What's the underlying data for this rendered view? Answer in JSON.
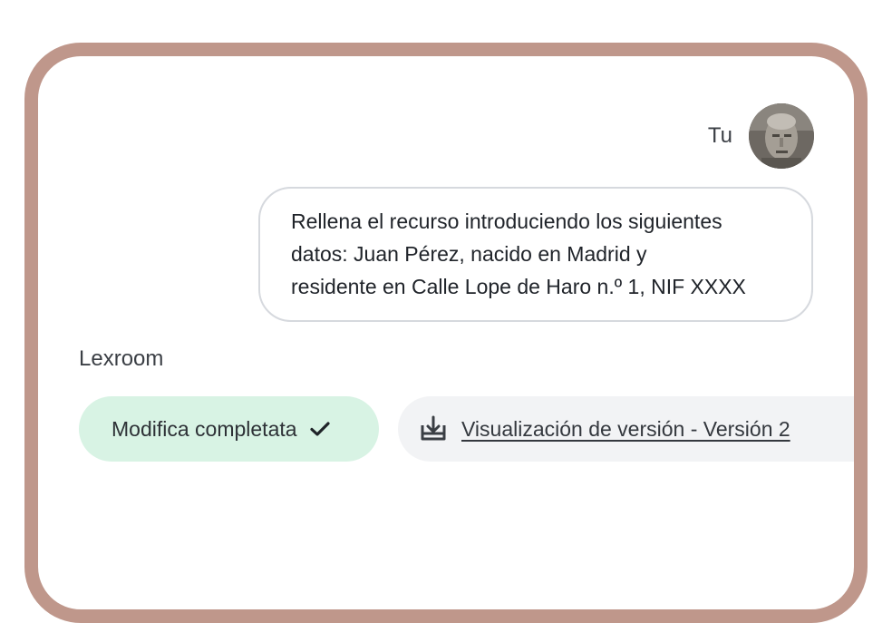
{
  "user": {
    "name": "Tu",
    "avatar_icon": "user-avatar"
  },
  "message": {
    "text": "Rellena el recurso introduciendo los siguientes\ndatos:  Juan Pérez, nacido en Madrid y\nresidente en Calle Lope de Haro n.º 1, NIF XXXX"
  },
  "assistant": {
    "name": "Lexroom"
  },
  "status": {
    "label": "Modifica completata",
    "icon": "check-icon",
    "color": "#d8f3e4"
  },
  "version": {
    "link_label": "Visualización de versión - Versión 2",
    "icon": "download-icon"
  },
  "colors": {
    "frame": "#bf978b",
    "bubble_border": "#d6d9de",
    "version_bg": "#f2f3f5"
  }
}
